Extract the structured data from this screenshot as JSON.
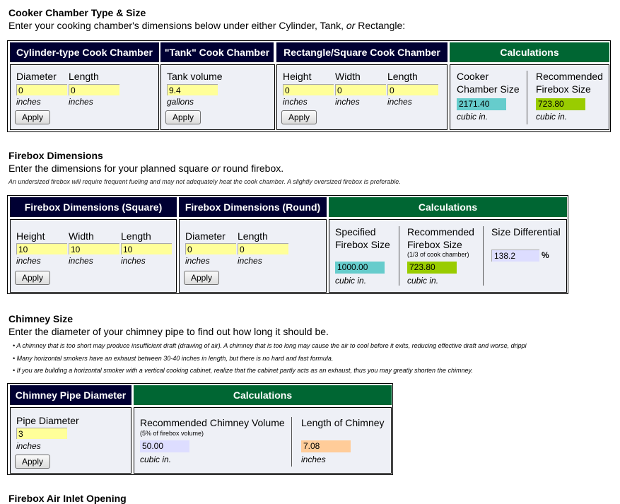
{
  "cooker": {
    "title": "Cooker Chamber Type & Size",
    "intro_pre": "Enter your cooking chamber's dimensions below under either Cylinder, Tank, ",
    "intro_or": "or",
    "intro_post": " Rectangle:",
    "cylinder": {
      "header": "Cylinder-type Cook Chamber",
      "diameter_label": "Diameter",
      "diameter_value": "0",
      "length_label": "Length",
      "length_value": "0",
      "unit": "inches",
      "apply": "Apply"
    },
    "tank": {
      "header": "\"Tank\" Cook Chamber",
      "volume_label": "Tank volume",
      "volume_value": "9.4",
      "unit": "gallons",
      "apply": "Apply"
    },
    "rect": {
      "header": "Rectangle/Square Cook Chamber",
      "height_label": "Height",
      "height_value": "0",
      "width_label": "Width",
      "width_value": "0",
      "length_label": "Length",
      "length_value": "0",
      "unit": "inches",
      "apply": "Apply"
    },
    "calc": {
      "header": "Calculations",
      "cooker_label_1": "Cooker",
      "cooker_label_2": "Chamber Size",
      "cooker_value": "2171.40",
      "rec_label_1": "Recommended",
      "rec_label_2": "Firebox Size",
      "rec_value": "723.80",
      "unit": "cubic in."
    }
  },
  "firebox": {
    "title": "Firebox Dimensions",
    "intro_pre": "Enter the dimensions for your planned square ",
    "intro_or": "or",
    "intro_post": " round firebox.",
    "note": "An undersized firebox will require frequent fueling and may not adequately heat the cook chamber. A slightly oversized firebox is preferable.",
    "square": {
      "header": "Firebox Dimensions (Square)",
      "height_label": "Height",
      "height_value": "10",
      "width_label": "Width",
      "width_value": "10",
      "length_label": "Length",
      "length_value": "10",
      "unit": "inches",
      "apply": "Apply"
    },
    "round": {
      "header": "Firebox Dimensions (Round)",
      "diameter_label": "Diameter",
      "diameter_value": "0",
      "length_label": "Length",
      "length_value": "0",
      "unit": "inches",
      "apply": "Apply"
    },
    "calc": {
      "header": "Calculations",
      "spec_label_1": "Specified",
      "spec_label_2": "Firebox Size",
      "spec_value": "1000.00",
      "rec_label_1": "Recommended",
      "rec_label_2": "Firebox Size",
      "rec_note": "(1/3 of cook chamber)",
      "rec_value": "723.80",
      "diff_label": "Size Differential",
      "diff_value": "138.2",
      "diff_unit": "%",
      "unit": "cubic in."
    }
  },
  "chimney": {
    "title": "Chimney Size",
    "intro": "Enter the diameter of your chimney pipe to find out how long it should be.",
    "bullets": [
      "• A chimney that is too short may produce insufficient draft (drawing of air). A chimney that is too long may cause the air to cool before it exits, reducing effective draft and worse, drippi",
      "• Many horizontal smokers have an exhaust between 30-40 inches in length, but there is no hard and fast formula.",
      "• If you are building a horizontal smoker with a vertical cooking cabinet, realize that the cabinet partly acts as an exhaust, thus you may greatly shorten the chimney."
    ],
    "pipe": {
      "header": "Chimney Pipe Diameter",
      "label": "Pipe Diameter",
      "value": "3",
      "unit": "inches",
      "apply": "Apply"
    },
    "calc": {
      "header": "Calculations",
      "vol_label": "Recommended Chimney Volume",
      "vol_note": "(5% of firebox volume)",
      "vol_value": "50.00",
      "vol_unit": "cubic in.",
      "len_label": "Length of Chimney",
      "len_value": "7.08",
      "len_unit": "inches"
    }
  },
  "next_section_title": "Firebox Air Inlet Opening",
  "colors": {
    "navy_header": "#000033",
    "green_header": "#006633",
    "input_yellow": "#ffff99",
    "teal_output": "#66cccc",
    "lime_output": "#99cc00",
    "lavender_output": "#ddddff",
    "peach_output": "#ffcc99"
  }
}
